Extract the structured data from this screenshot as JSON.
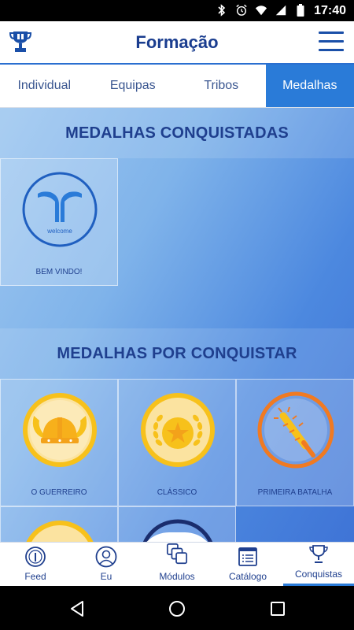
{
  "status_bar": {
    "time": "17:40",
    "icons": [
      "bluetooth-icon",
      "alarm-icon",
      "wifi-icon",
      "signal-icon",
      "battery-icon"
    ]
  },
  "app_bar": {
    "title": "Formação",
    "logo": "trophy-logo-icon",
    "menu_icon": "hamburger-menu-icon"
  },
  "tabs": [
    {
      "label": "Individual",
      "active": false
    },
    {
      "label": "Equipas",
      "active": false
    },
    {
      "label": "Tribos",
      "active": false
    },
    {
      "label": "Medalhas",
      "active": true
    }
  ],
  "sections": {
    "earned": {
      "title": "MEDALHAS CONQUISTADAS",
      "medals": [
        {
          "label": "BEM VINDO!",
          "icon": "welcome-medal-icon",
          "logo_text": "welcome"
        }
      ]
    },
    "to_earn": {
      "title": "MEDALHAS POR CONQUISTAR",
      "medals": [
        {
          "label": "O GUERREIRO",
          "icon": "viking-helmet-medal-icon"
        },
        {
          "label": "CLÁSSICO",
          "icon": "laurel-star-medal-icon"
        },
        {
          "label": "PRIMEIRA BATALHA",
          "icon": "spiked-club-medal-icon"
        },
        {
          "label": "",
          "icon": "partial-yellow-medal-icon"
        },
        {
          "label": "",
          "icon": "partial-navy-medal-icon"
        }
      ]
    }
  },
  "bottom_nav": [
    {
      "label": "Feed",
      "icon": "feed-gauge-icon",
      "active": false
    },
    {
      "label": "Eu",
      "icon": "user-icon",
      "active": false
    },
    {
      "label": "Módulos",
      "icon": "modules-stack-icon",
      "active": false
    },
    {
      "label": "Catálogo",
      "icon": "catalog-list-icon",
      "active": false
    },
    {
      "label": "Conquistas",
      "icon": "trophy-icon",
      "active": true
    }
  ],
  "colors": {
    "brand_blue": "#1a3d8f",
    "accent_blue": "#2a7bd8",
    "gold": "#f7c11b",
    "orange": "#f07a22"
  }
}
